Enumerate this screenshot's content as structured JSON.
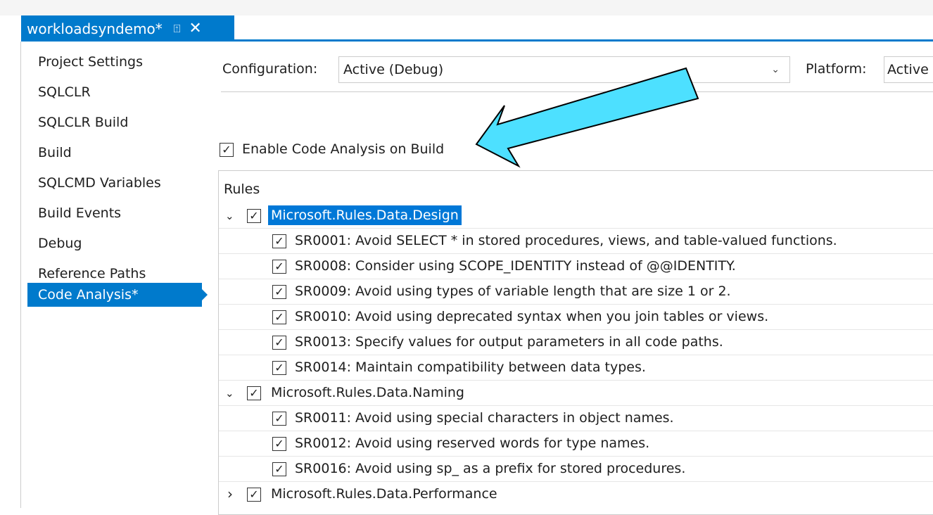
{
  "tab": {
    "title": "workloadsyndemo*",
    "pin_glyph": "⍐",
    "close_glyph": "✕"
  },
  "sidebar": {
    "items": [
      {
        "label": "Project Settings",
        "active": false
      },
      {
        "label": "SQLCLR",
        "active": false
      },
      {
        "label": "SQLCLR Build",
        "active": false
      },
      {
        "label": "Build",
        "active": false
      },
      {
        "label": "SQLCMD Variables",
        "active": false
      },
      {
        "label": "Build Events",
        "active": false
      },
      {
        "label": "Debug",
        "active": false
      },
      {
        "label": "Reference Paths",
        "active": false
      },
      {
        "label": "Code Analysis*",
        "active": true
      }
    ]
  },
  "config": {
    "configuration_label": "Configuration:",
    "configuration_value": "Active (Debug)",
    "platform_label": "Platform:",
    "platform_value": "Active"
  },
  "code_analysis": {
    "enable_label": "Enable Code Analysis on Build",
    "enable_checked": true
  },
  "rules": {
    "header": "Rules",
    "rows": [
      {
        "type": "group",
        "text": "Microsoft.Rules.Data.Design",
        "expanded": true,
        "checked": true,
        "selected": true
      },
      {
        "type": "rule",
        "text": "SR0001: Avoid SELECT * in stored procedures, views, and table-valued functions.",
        "checked": true
      },
      {
        "type": "rule",
        "text": "SR0008: Consider using SCOPE_IDENTITY instead of @@IDENTITY.",
        "checked": true
      },
      {
        "type": "rule",
        "text": "SR0009: Avoid using types of variable length that are size 1 or 2.",
        "checked": true
      },
      {
        "type": "rule",
        "text": "SR0010: Avoid using deprecated syntax when you join tables or views.",
        "checked": true
      },
      {
        "type": "rule",
        "text": "SR0013: Specify values for output parameters in all code paths.",
        "checked": true
      },
      {
        "type": "rule",
        "text": "SR0014: Maintain compatibility between data types.",
        "checked": true
      },
      {
        "type": "group",
        "text": "Microsoft.Rules.Data.Naming",
        "expanded": true,
        "checked": true,
        "selected": false
      },
      {
        "type": "rule",
        "text": "SR0011: Avoid using special characters in object names.",
        "checked": true
      },
      {
        "type": "rule",
        "text": "SR0012: Avoid using reserved words for type names.",
        "checked": true
      },
      {
        "type": "rule",
        "text": "SR0016: Avoid using sp_ as a prefix for stored procedures.",
        "checked": true
      },
      {
        "type": "group",
        "text": "Microsoft.Rules.Data.Performance",
        "expanded": false,
        "checked": true,
        "selected": false
      }
    ]
  },
  "colors": {
    "accent": "#007acc",
    "selection": "#0078d7",
    "arrow_fill": "#4de0ff"
  },
  "icons": {
    "check": "✓",
    "expanded": "⌄",
    "collapsed": "›",
    "combo_chevron": "⌵"
  }
}
